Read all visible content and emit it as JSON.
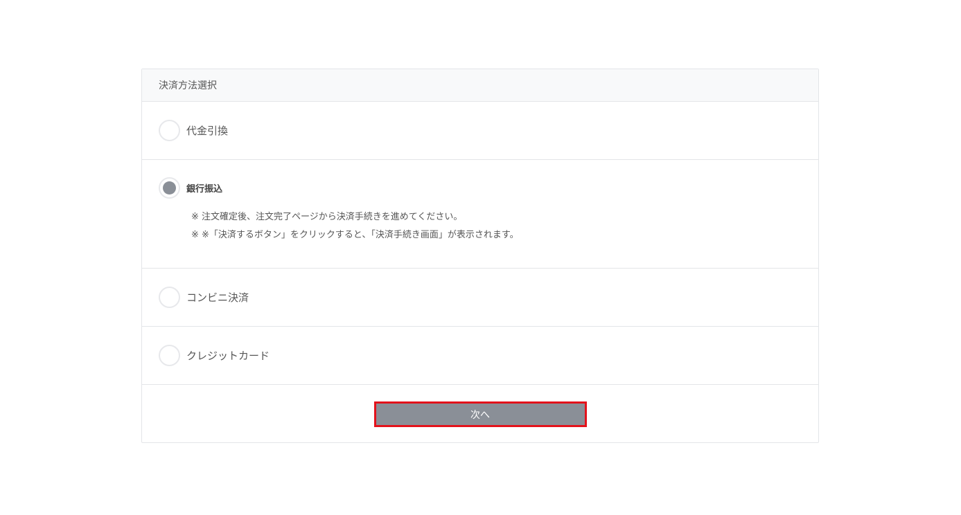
{
  "panel": {
    "title": "決済方法選択"
  },
  "payment_options": [
    {
      "label": "代金引換",
      "selected": false
    },
    {
      "label": "銀行振込",
      "selected": true,
      "notes": [
        "※ 注文確定後、注文完了ページから決済手続きを進めてください。",
        "※ ※「決済するボタン」をクリックすると、「決済手続き画面」が表示されます。"
      ]
    },
    {
      "label": "コンビニ決済",
      "selected": false
    },
    {
      "label": "クレジットカード",
      "selected": false
    }
  ],
  "footer": {
    "next_label": "次へ"
  },
  "colors": {
    "header_bg": "#f8f9fa",
    "border": "#e3e5e8",
    "radio_fill": "#8a8f97",
    "button_bg": "#8a8f97",
    "button_highlight_border": "#e3121b"
  }
}
